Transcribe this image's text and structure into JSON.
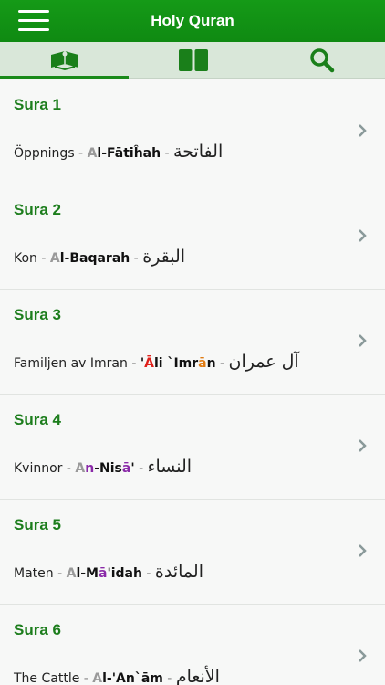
{
  "app": {
    "title": "Holy Quran"
  },
  "tabs": [
    {
      "icon": "quran-book-icon"
    },
    {
      "icon": "open-book-icon"
    },
    {
      "icon": "search-icon"
    }
  ],
  "suras": [
    {
      "label": "Sura 1",
      "swedish": "Öppnings",
      "translit_parts": [
        {
          "t": "A",
          "c": "gray"
        },
        {
          "t": "l-Fātiĥah",
          "c": "blk"
        }
      ],
      "arabic": "الفاتحة"
    },
    {
      "label": "Sura 2",
      "swedish": "Kon",
      "translit_parts": [
        {
          "t": "A",
          "c": "gray"
        },
        {
          "t": "l-Baqarah",
          "c": "blk"
        }
      ],
      "arabic": "البقرة"
    },
    {
      "label": "Sura 3",
      "swedish": "Familjen av Imran",
      "translit_parts": [
        {
          "t": "'",
          "c": "blk"
        },
        {
          "t": "Ā",
          "c": "red"
        },
        {
          "t": "li `Imr",
          "c": "blk"
        },
        {
          "t": "ā",
          "c": "orange"
        },
        {
          "t": "n",
          "c": "blk"
        }
      ],
      "arabic": "آل عمران"
    },
    {
      "label": "Sura 4",
      "swedish": "Kvinnor",
      "translit_parts": [
        {
          "t": "A",
          "c": "gray"
        },
        {
          "t": "n",
          "c": "purple"
        },
        {
          "t": "-Nis",
          "c": "blk"
        },
        {
          "t": "ā",
          "c": "purple"
        },
        {
          "t": "'",
          "c": "blk"
        }
      ],
      "arabic": "النساء"
    },
    {
      "label": "Sura 5",
      "swedish": "Maten",
      "translit_parts": [
        {
          "t": "A",
          "c": "gray"
        },
        {
          "t": "l-M",
          "c": "blk"
        },
        {
          "t": "ā",
          "c": "purple"
        },
        {
          "t": "'idah",
          "c": "blk"
        }
      ],
      "arabic": "المائدة"
    },
    {
      "label": "Sura 6",
      "swedish": "The Cattle",
      "translit_parts": [
        {
          "t": "A",
          "c": "gray"
        },
        {
          "t": "l-'An`ām",
          "c": "blk"
        }
      ],
      "arabic": "الأنعام"
    }
  ],
  "colors": {
    "header": "#129214",
    "accent": "#1c7d1c",
    "tab_bar": "#d9e7d9"
  }
}
